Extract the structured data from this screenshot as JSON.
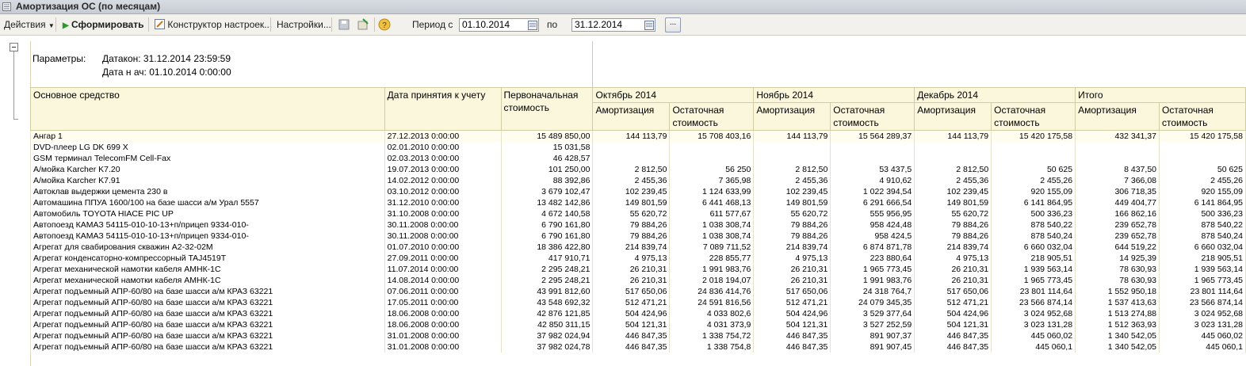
{
  "window": {
    "title": "Амортизация ОС (по месяцам)"
  },
  "toolbar": {
    "actions_label": "Действия",
    "generate_label": "Сформировать",
    "constructor_label": "Конструктор настроек...",
    "settings_label": "Настройки...",
    "period_from_label": "Период с",
    "period_from_value": "01.10.2014",
    "period_to_label": "по",
    "period_to_value": "31.12.2014"
  },
  "params": {
    "label": "Параметры:",
    "line1": "Датакон: 31.12.2014 23:59:59",
    "line2": "Дата н ач: 01.10.2014 0:00:00"
  },
  "headers": {
    "asset": "Основное средство",
    "date": "Дата принятия к учету",
    "initial": "Первоначальная стоимость",
    "groups": [
      "Октябрь 2014",
      "Ноябрь 2014",
      "Декабрь 2014",
      "Итого"
    ],
    "amort": "Амортизация",
    "residual": "Остаточная стоимость"
  },
  "rows": [
    {
      "name": "Ангар 1",
      "date": "27.12.2013 0:00:00",
      "initial": "15 489 850,00",
      "vals": [
        "144 113,79",
        "15 708 403,16",
        "144 113,79",
        "15 564 289,37",
        "144 113,79",
        "15 420 175,58",
        "432 341,37",
        "15 420 175,58"
      ]
    },
    {
      "name": "DVD-плеер LG DK 699 X",
      "date": "02.01.2010 0:00:00",
      "initial": "15 031,58",
      "vals": [
        "",
        "",
        "",
        "",
        "",
        "",
        "",
        ""
      ]
    },
    {
      "name": "GSM терминал TelecomFM Cell-Fax",
      "date": "02.03.2013 0:00:00",
      "initial": "46 428,57",
      "vals": [
        "",
        "",
        "",
        "",
        "",
        "",
        "",
        ""
      ]
    },
    {
      "name": "А/мойка Karcher K7.20",
      "date": "19.07.2013 0:00:00",
      "initial": "101 250,00",
      "vals": [
        "2 812,50",
        "56 250",
        "2 812,50",
        "53 437,5",
        "2 812,50",
        "50 625",
        "8 437,50",
        "50 625"
      ]
    },
    {
      "name": "А/мойка Karcher K7.91",
      "date": "14.02.2012 0:00:00",
      "initial": "88 392,86",
      "vals": [
        "2 455,36",
        "7 365,98",
        "2 455,36",
        "4 910,62",
        "2 455,36",
        "2 455,26",
        "7 366,08",
        "2 455,26"
      ]
    },
    {
      "name": "Автоклав выдержки цемента 230 в",
      "date": "03.10.2012 0:00:00",
      "initial": "3 679 102,47",
      "vals": [
        "102 239,45",
        "1 124 633,99",
        "102 239,45",
        "1 022 394,54",
        "102 239,45",
        "920 155,09",
        "306 718,35",
        "920 155,09"
      ]
    },
    {
      "name": "Автомашина ППУА 1600/100 на базе шасси а/м Урал 5557",
      "date": "31.12.2010 0:00:00",
      "initial": "13 482 142,86",
      "vals": [
        "149 801,59",
        "6 441 468,13",
        "149 801,59",
        "6 291 666,54",
        "149 801,59",
        "6 141 864,95",
        "449 404,77",
        "6 141 864,95"
      ]
    },
    {
      "name": "Автомобиль   TOYOTA HIACE PIC UP",
      "date": "31.10.2008 0:00:00",
      "initial": "4 672 140,58",
      "vals": [
        "55 620,72",
        "611 577,67",
        "55 620,72",
        "555 956,95",
        "55 620,72",
        "500 336,23",
        "166 862,16",
        "500 336,23"
      ]
    },
    {
      "name": "Автопоезд КАМАЗ 54115-010-10-13+п/прицеп 9334-010-",
      "date": "30.11.2008 0:00:00",
      "initial": "6 790 161,80",
      "vals": [
        "79 884,26",
        "1 038 308,74",
        "79 884,26",
        "958 424,48",
        "79 884,26",
        "878 540,22",
        "239 652,78",
        "878 540,22"
      ]
    },
    {
      "name": "Автопоезд КАМАЗ 54115-010-10-13+п/прицеп 9334-010-",
      "date": "30.11.2008 0:00:00",
      "initial": "6 790 161,80",
      "vals": [
        "79 884,26",
        "1 038 308,74",
        "79 884,26",
        "958 424,5",
        "79 884,26",
        "878 540,24",
        "239 652,78",
        "878 540,24"
      ]
    },
    {
      "name": "Агрегат для свабирования скважин А2-32-02М",
      "date": "01.07.2010 0:00:00",
      "initial": "18 386 422,80",
      "vals": [
        "214 839,74",
        "7 089 711,52",
        "214 839,74",
        "6 874 871,78",
        "214 839,74",
        "6 660 032,04",
        "644 519,22",
        "6 660 032,04"
      ]
    },
    {
      "name": "Агрегат конденсаторно-компрессорный TAJ4519T",
      "date": "27.09.2011 0:00:00",
      "initial": "417 910,71",
      "vals": [
        "4 975,13",
        "228 855,77",
        "4 975,13",
        "223 880,64",
        "4 975,13",
        "218 905,51",
        "14 925,39",
        "218 905,51"
      ]
    },
    {
      "name": "Агрегат механической намотки кабеля АМНК-1С",
      "date": "11.07.2014 0:00:00",
      "initial": "2 295 248,21",
      "vals": [
        "26 210,31",
        "1 991 983,76",
        "26 210,31",
        "1 965 773,45",
        "26 210,31",
        "1 939 563,14",
        "78 630,93",
        "1 939 563,14"
      ]
    },
    {
      "name": "Агрегат механической намотки кабеля АМНК-1С",
      "date": "14.08.2014 0:00:00",
      "initial": "2 295 248,21",
      "vals": [
        "26 210,31",
        "2 018 194,07",
        "26 210,31",
        "1 991 983,76",
        "26 210,31",
        "1 965 773,45",
        "78 630,93",
        "1 965 773,45"
      ]
    },
    {
      "name": "Агрегат подъемный АПР-60/80 на базе шасси а/м КРАЗ 63221",
      "date": "07.06.2011 0:00:00",
      "initial": "43 991 812,60",
      "vals": [
        "517 650,06",
        "24 836 414,76",
        "517 650,06",
        "24 318 764,7",
        "517 650,06",
        "23 801 114,64",
        "1 552 950,18",
        "23 801 114,64"
      ]
    },
    {
      "name": "Агрегат подъемный АПР-60/80 на базе шасси а/м КРАЗ 63221",
      "date": "17.05.2011 0:00:00",
      "initial": "43 548 692,32",
      "vals": [
        "512 471,21",
        "24 591 816,56",
        "512 471,21",
        "24 079 345,35",
        "512 471,21",
        "23 566 874,14",
        "1 537 413,63",
        "23 566 874,14"
      ]
    },
    {
      "name": "Агрегат подъемный АПР-60/80 на базе шасси а/м КРАЗ 63221",
      "date": "18.06.2008 0:00:00",
      "initial": "42 876 121,85",
      "vals": [
        "504 424,96",
        "4 033 802,6",
        "504 424,96",
        "3 529 377,64",
        "504 424,96",
        "3 024 952,68",
        "1 513 274,88",
        "3 024 952,68"
      ]
    },
    {
      "name": "Агрегат подъемный АПР-60/80 на базе шасси а/м КРАЗ 63221",
      "date": "18.06.2008 0:00:00",
      "initial": "42 850 311,15",
      "vals": [
        "504 121,31",
        "4 031 373,9",
        "504 121,31",
        "3 527 252,59",
        "504 121,31",
        "3 023 131,28",
        "1 512 363,93",
        "3 023 131,28"
      ]
    },
    {
      "name": "Агрегат подъемный АПР-60/80 на базе шасси а/м КРАЗ 63221",
      "date": "31.01.2008 0:00:00",
      "initial": "37 982 024,94",
      "vals": [
        "446 847,35",
        "1 338 754,72",
        "446 847,35",
        "891 907,37",
        "446 847,35",
        "445 060,02",
        "1 340 542,05",
        "445 060,02"
      ]
    },
    {
      "name": "Агрегат подъемный АПР-60/80 на базе шасси а/м КРАЗ 63221",
      "date": "31.01.2008 0:00:00",
      "initial": "37 982 024,78",
      "vals": [
        "446 847,35",
        "1 338 754,8",
        "446 847,35",
        "891 907,45",
        "446 847,35",
        "445 060,1",
        "1 340 542,05",
        "445 060,1"
      ]
    }
  ]
}
